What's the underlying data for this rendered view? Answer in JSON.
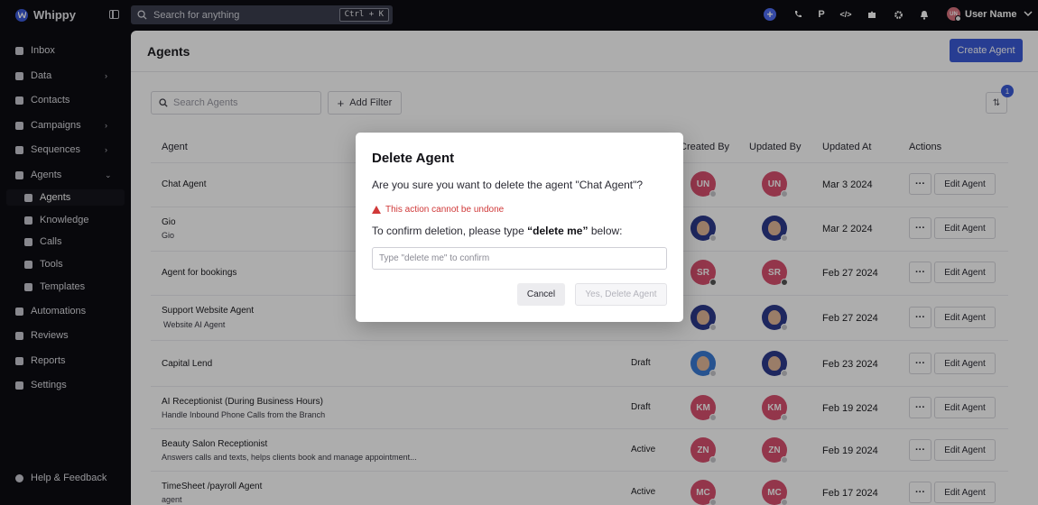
{
  "app": {
    "name": "Whippy",
    "logo_icon": "whippy-logo-icon"
  },
  "topbar": {
    "search_placeholder": "Search for anything",
    "search_shortcut": "Ctrl + K",
    "user_initials": "UN",
    "user_name": "User Name",
    "p_label": "P",
    "code_label": "</>"
  },
  "sidebar": {
    "items": [
      {
        "label": "Inbox",
        "icon": "inbox-icon"
      },
      {
        "label": "Data",
        "icon": "database-icon",
        "chevron": "›"
      },
      {
        "label": "Contacts",
        "icon": "contacts-icon"
      },
      {
        "label": "Campaigns",
        "icon": "megaphone-icon",
        "chevron": "›"
      },
      {
        "label": "Sequences",
        "icon": "sequence-icon",
        "chevron": "›"
      },
      {
        "label": "Agents",
        "icon": "sparkle-icon",
        "chevron": "⌄"
      },
      {
        "label": "Automations",
        "icon": "bolt-icon"
      },
      {
        "label": "Reviews",
        "icon": "star-icon"
      },
      {
        "label": "Reports",
        "icon": "chart-icon"
      },
      {
        "label": "Settings",
        "icon": "gear-icon"
      }
    ],
    "sub_items": [
      {
        "label": "Agents",
        "active": true
      },
      {
        "label": "Knowledge"
      },
      {
        "label": "Calls"
      },
      {
        "label": "Tools"
      },
      {
        "label": "Templates"
      }
    ],
    "help": "Help & Feedback"
  },
  "page": {
    "title": "Agents",
    "create_button": "Create Agent",
    "search_placeholder": "Search Agents",
    "add_filter": "Add Filter",
    "sort_badge": "1"
  },
  "table": {
    "headers": {
      "agent": "Agent",
      "created_by": "Created By",
      "updated_by": "Updated By",
      "updated_at": "Updated At",
      "actions": "Actions"
    },
    "edit_label": "Edit Agent",
    "more_label": "···",
    "rows": [
      {
        "name": "Chat Agent",
        "desc": "",
        "status": "",
        "created": "UN",
        "updated": "UN",
        "date": "Mar 3 2024"
      },
      {
        "name": "Gio",
        "desc": "Gio",
        "status": "",
        "created": "",
        "updated": "",
        "date": "Mar 2 2024"
      },
      {
        "name": "Agent for bookings",
        "desc": "",
        "status": "",
        "created": "SR",
        "updated": "SR",
        "date": "Feb 27 2024"
      },
      {
        "name": "Support Website Agent",
        "desc": "Website AI Agent",
        "status": "",
        "created": "",
        "updated": "",
        "date": "Feb 27 2024"
      },
      {
        "name": "Capital Lend",
        "desc": "",
        "status": "Draft",
        "created": "",
        "updated": "",
        "date": "Feb 23 2024"
      },
      {
        "name": "AI Receptionist (During Business Hours)",
        "desc": "Handle Inbound Phone Calls from the Branch",
        "status": "Draft",
        "created": "KM",
        "updated": "KM",
        "date": "Feb 19 2024"
      },
      {
        "name": "Beauty Salon Receptionist",
        "desc": "Answers calls and texts, helps clients book and manage appointment...",
        "status": "Active",
        "created": "ZN",
        "updated": "ZN",
        "date": "Feb 19 2024"
      },
      {
        "name": "TimeSheet /payroll Agent",
        "desc": "agent",
        "status": "Active",
        "created": "MC",
        "updated": "MC",
        "date": "Feb 17 2024"
      }
    ]
  },
  "modal": {
    "title": "Delete Agent",
    "question": "Are you sure you want to delete the agent \"Chat Agent\"?",
    "warning": "This action cannot be undone",
    "confirm_prefix": "To confirm deletion, please type",
    "confirm_phrase": "“delete me”",
    "confirm_suffix": "below:",
    "input_placeholder": "Type \"delete me\" to confirm",
    "cancel": "Cancel",
    "delete": "Yes, Delete Agent"
  },
  "colors": {
    "accent": "#3a5ad8",
    "danger": "#d03838",
    "sidebar_bg": "#0d0d12"
  }
}
